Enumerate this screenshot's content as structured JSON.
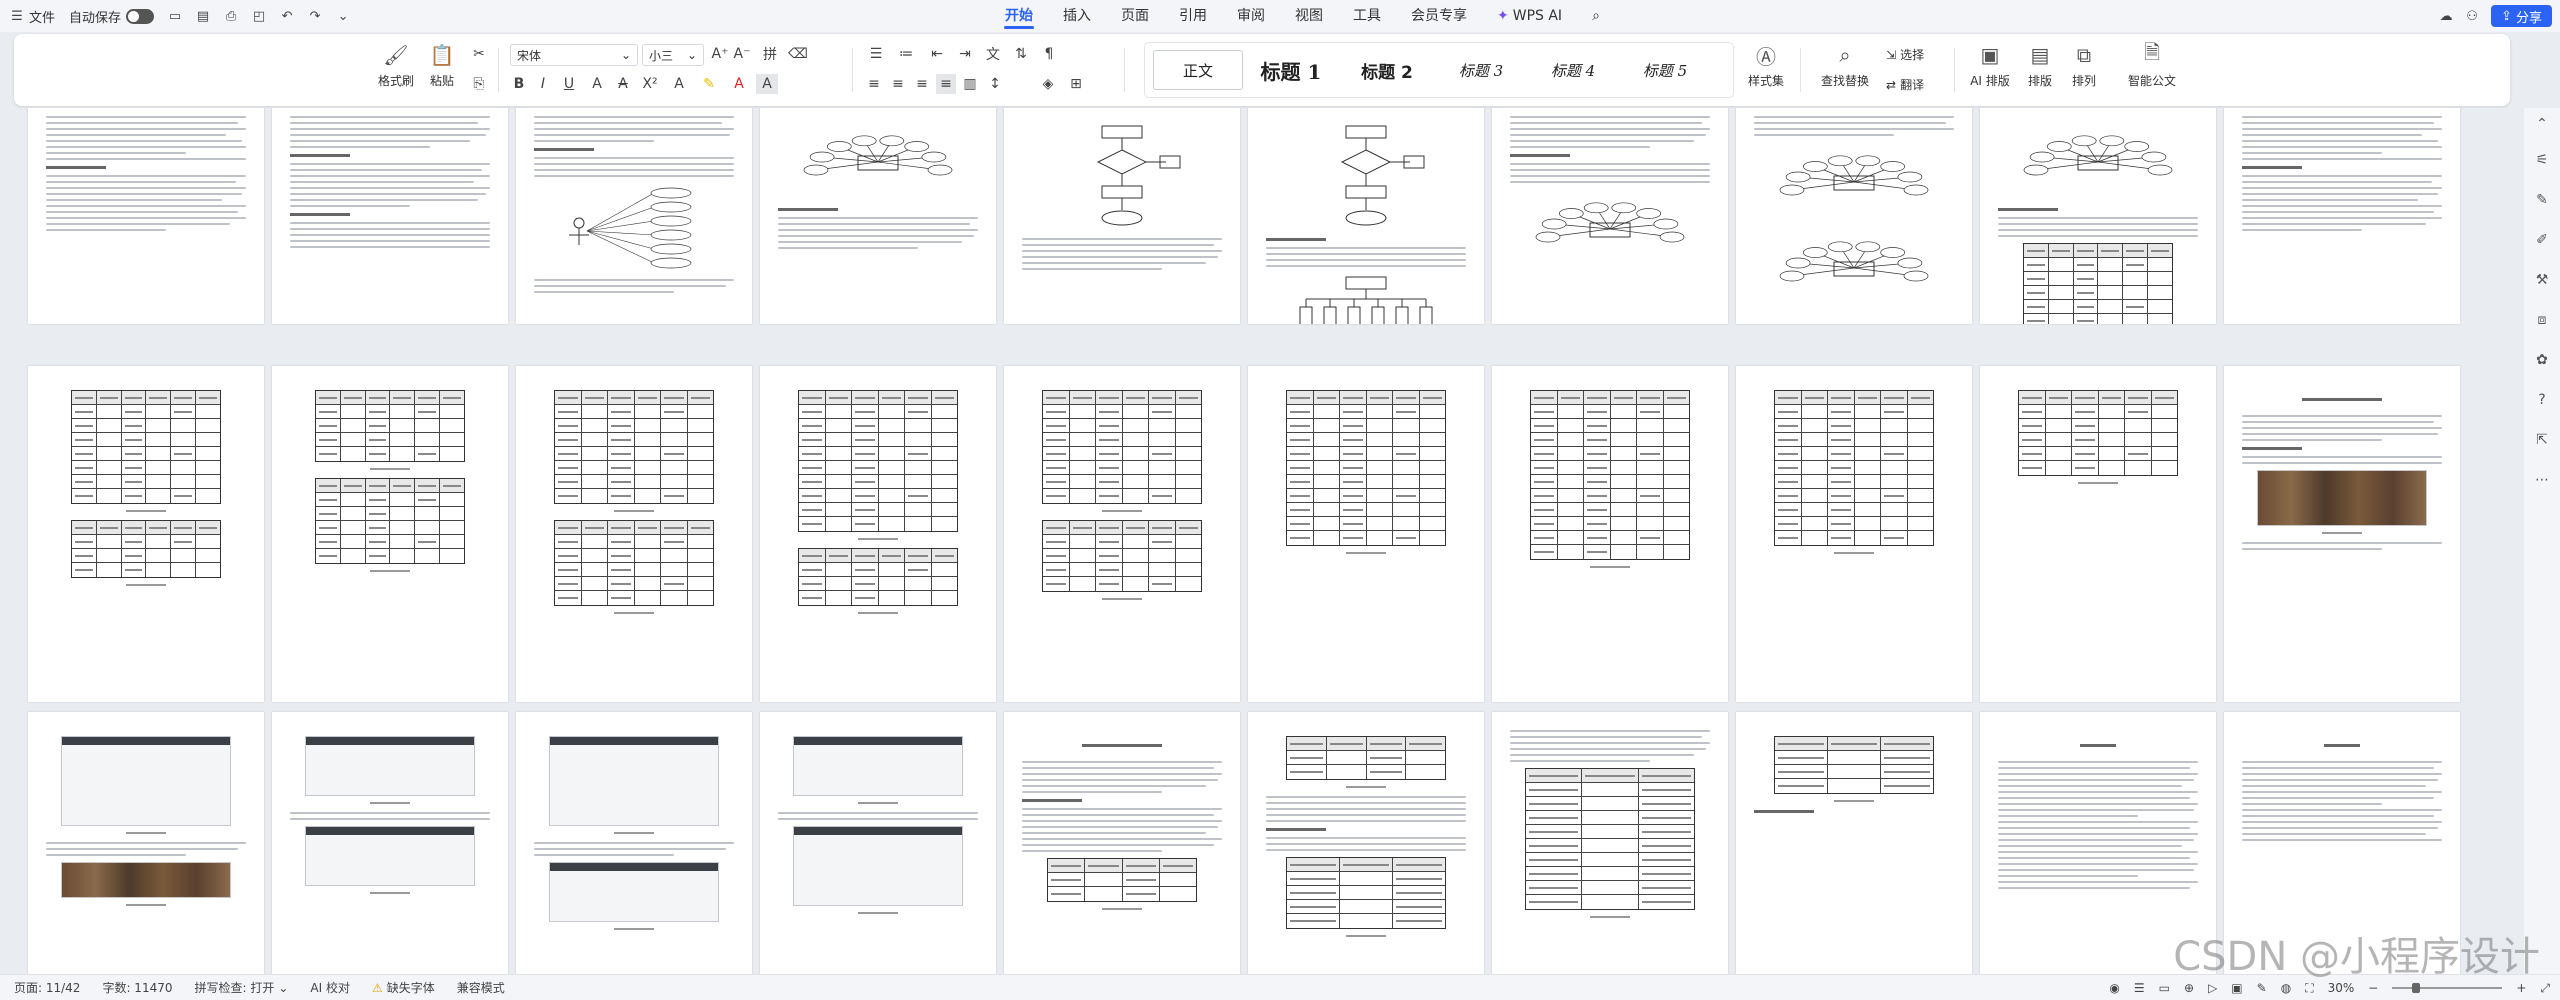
{
  "menubar": {
    "menu_label": "文件",
    "autosave_label": "自动保存",
    "tabs": [
      "开始",
      "插入",
      "页面",
      "引用",
      "审阅",
      "视图",
      "工具",
      "会员专享",
      "WPS AI"
    ],
    "share_label": "分享"
  },
  "ribbon": {
    "format_painter": "格式刷",
    "paste": "粘贴",
    "font_name": "宋体",
    "font_size": "小三",
    "styles": [
      "正文",
      "标题 1",
      "标题 2",
      "标题 3",
      "标题 4",
      "标题 5"
    ],
    "style_set": "样式集",
    "find_replace": "查找替换",
    "select": "选择",
    "translate": "翻译",
    "ai_layout": "AI 排版",
    "layout": "排版",
    "arrange": "排列",
    "smart_doc": "智能公文"
  },
  "document": {
    "chapter_title_1": "第 5 章  系统实现",
    "chapter_title_2": "第 6 章  系统测试",
    "conclusion_title": "结论",
    "thanks_title": "致谢"
  },
  "statusbar": {
    "page": "页面: 11/42",
    "word_count": "字数: 11470",
    "spell_check": "拼写检查: 打开",
    "ai_proof": "AI 校对",
    "missing_font": "缺失字体",
    "compat_mode": "兼容模式",
    "zoom": "30%"
  },
  "watermark": "CSDN @小程序设计",
  "colors": {
    "accent": "#2b64f5",
    "warning": "#e6a100"
  }
}
